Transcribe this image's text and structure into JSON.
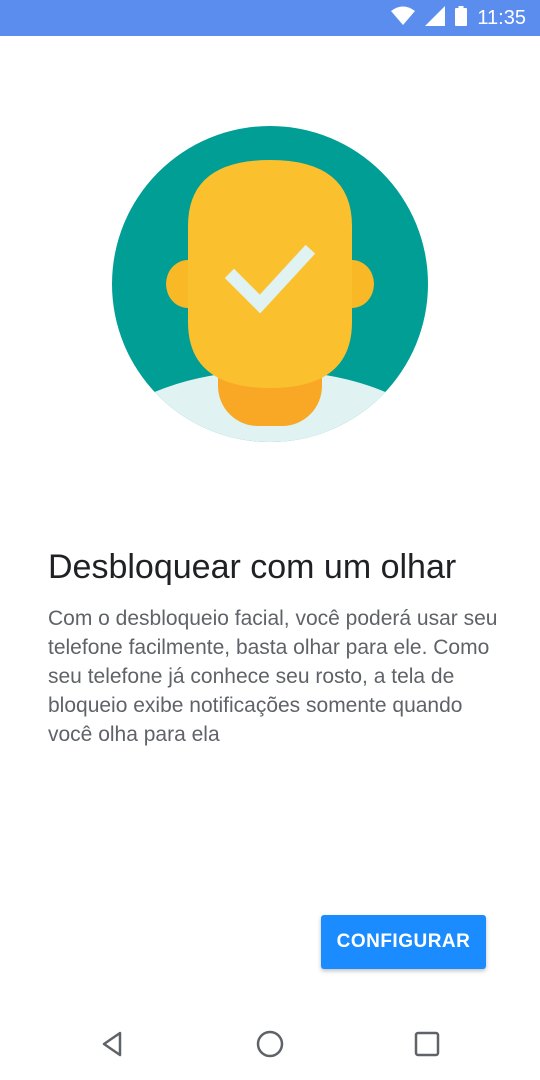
{
  "status_bar": {
    "time": "11:35",
    "icons": [
      "wifi-icon",
      "cellular-signal-icon",
      "battery-icon"
    ],
    "background": "#5b8def"
  },
  "illustration": {
    "icon": "face-unlock-check-illustration",
    "circle_color": "#009e95",
    "face_color": "#fbc02d",
    "check_color": "#e0f2f1",
    "shirt_color": "#e0f2f1"
  },
  "content": {
    "title": "Desbloquear com um olhar",
    "description": "Com o desbloqueio facial, você poderá usar seu telefone facilmente, basta olhar para ele. Como seu telefone já conhece seu rosto, a tela de bloqueio exibe notificações somente quando você olha para ela"
  },
  "actions": {
    "configure_label": "CONFIGURAR",
    "accent": "#1a8cff"
  },
  "nav_bar": {
    "buttons": [
      "back-icon",
      "home-icon",
      "recents-icon"
    ]
  }
}
